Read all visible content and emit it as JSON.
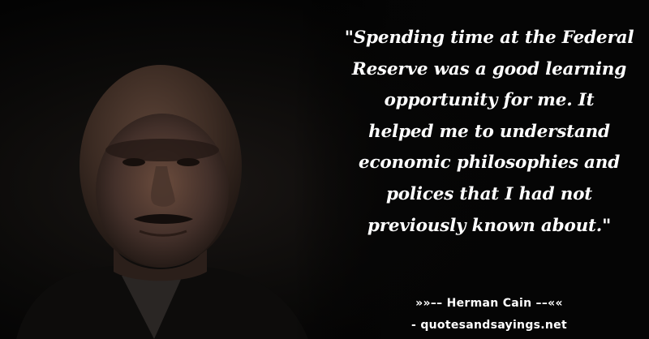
{
  "quote": {
    "lines": [
      "\"Spending time at the Federal",
      "Reserve was a good learning",
      "opportunity for me. It",
      "helped me to understand",
      "economic philosophies and",
      "polices that I had not",
      "previously known about.\""
    ]
  },
  "author_line": "»»–– Herman Cain ––««",
  "site_line": "- quotesandsayings.net",
  "colors": {
    "background": "#050505",
    "text": "#ffffff"
  }
}
